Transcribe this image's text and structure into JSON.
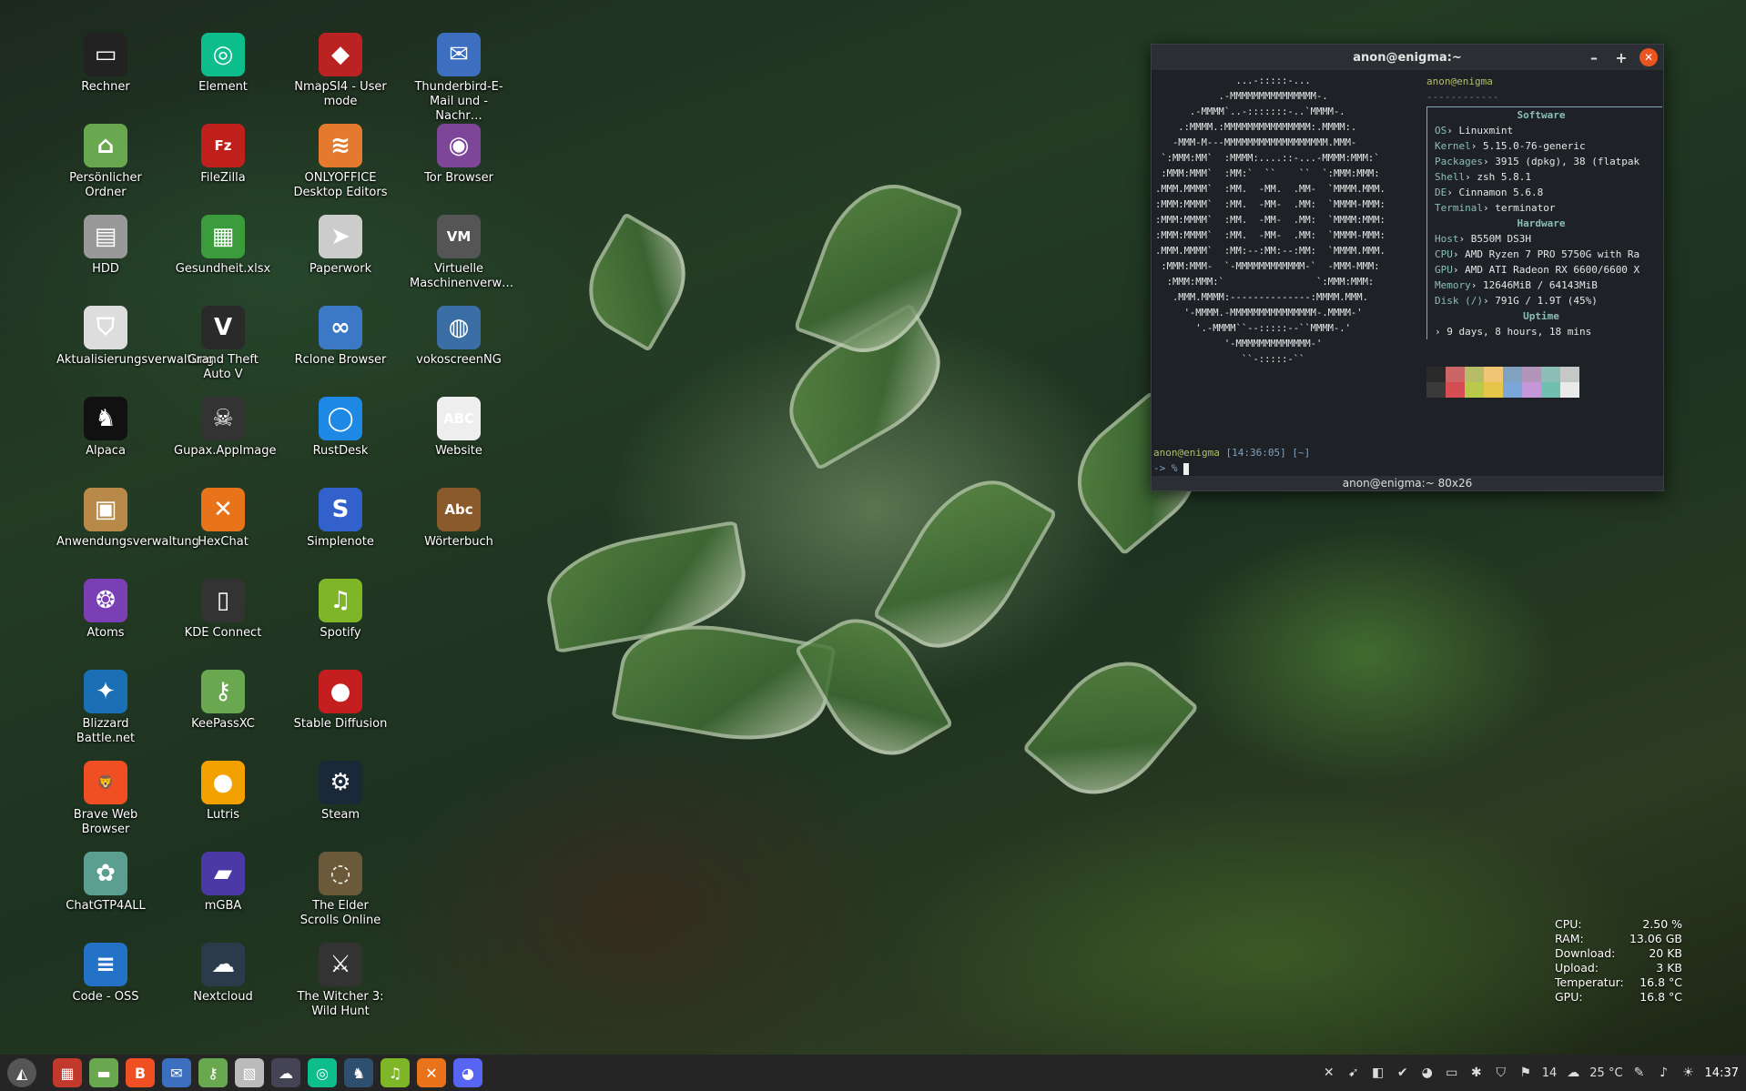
{
  "desktop_icons": [
    {
      "label": "Rechner",
      "glyph": "▭",
      "color": "#222"
    },
    {
      "label": "Element",
      "glyph": "◎",
      "color": "#0dbd8b"
    },
    {
      "label": "NmapSI4 - User mode",
      "glyph": "◆",
      "color": "#b22"
    },
    {
      "label": "Thunderbird-E-Mail und -Nachr…",
      "glyph": "✉",
      "color": "#3d6fc0"
    },
    {
      "label": "Persönlicher Ordner",
      "glyph": "⌂",
      "color": "#6aa84f"
    },
    {
      "label": "FileZilla",
      "glyph": "Fz",
      "color": "#c0201b"
    },
    {
      "label": "ONLYOFFICE Desktop Editors",
      "glyph": "≋",
      "color": "#e47a2e"
    },
    {
      "label": "Tor Browser",
      "glyph": "◉",
      "color": "#7d4698"
    },
    {
      "label": "HDD",
      "glyph": "▤",
      "color": "#999"
    },
    {
      "label": "Gesundheit.xlsx",
      "glyph": "▦",
      "color": "#3a9c3a"
    },
    {
      "label": "Paperwork",
      "glyph": "➤",
      "color": "#ccc"
    },
    {
      "label": "Virtuelle Maschinenverw…",
      "glyph": "VM",
      "color": "#555"
    },
    {
      "label": "Aktualisierungsverwaltung",
      "glyph": "⛉",
      "color": "#ddd"
    },
    {
      "label": "Grand Theft Auto V",
      "glyph": "V",
      "color": "#2a2a2a"
    },
    {
      "label": "Rclone Browser",
      "glyph": "∞",
      "color": "#3b79c7"
    },
    {
      "label": "vokoscreenNG",
      "glyph": "◍",
      "color": "#3b6ea5"
    },
    {
      "label": "Alpaca",
      "glyph": "♞",
      "color": "#111"
    },
    {
      "label": "Gupax.AppImage",
      "glyph": "☠",
      "color": "#333"
    },
    {
      "label": "RustDesk",
      "glyph": "◯",
      "color": "#1e88e5"
    },
    {
      "label": "Website",
      "glyph": "ABC",
      "color": "#eee"
    },
    {
      "label": "Anwendungsverwaltung",
      "glyph": "▣",
      "color": "#b9894a"
    },
    {
      "label": "HexChat",
      "glyph": "✕",
      "color": "#e8731a"
    },
    {
      "label": "Simplenote",
      "glyph": "S",
      "color": "#3361cc"
    },
    {
      "label": "Wörterbuch",
      "glyph": "Abc",
      "color": "#8b5a2b"
    },
    {
      "label": "Atoms",
      "glyph": "❂",
      "color": "#7b3fb5"
    },
    {
      "label": "KDE Connect",
      "glyph": "▯",
      "color": "#333"
    },
    {
      "label": "Spotify",
      "glyph": "♫",
      "color": "#7fb628"
    },
    {
      "label": "",
      "glyph": "",
      "color": "transparent"
    },
    {
      "label": "Blizzard Battle.net",
      "glyph": "✦",
      "color": "#1a6fb5"
    },
    {
      "label": "KeePassXC",
      "glyph": "⚷",
      "color": "#6aa84f"
    },
    {
      "label": "Stable Diffusion",
      "glyph": "●",
      "color": "#c41e1e"
    },
    {
      "label": "",
      "glyph": "",
      "color": "transparent"
    },
    {
      "label": "Brave Web Browser",
      "glyph": "🦁",
      "color": "#f04e23"
    },
    {
      "label": "Lutris",
      "glyph": "●",
      "color": "#f2a100"
    },
    {
      "label": "Steam",
      "glyph": "⚙",
      "color": "#1b2838"
    },
    {
      "label": "",
      "glyph": "",
      "color": "transparent"
    },
    {
      "label": "ChatGTP4ALL",
      "glyph": "✿",
      "color": "#5a9f90"
    },
    {
      "label": "mGBA",
      "glyph": "▰",
      "color": "#4b3aa5"
    },
    {
      "label": "The Elder Scrolls Online",
      "glyph": "◌",
      "color": "#6b5a3a"
    },
    {
      "label": "",
      "glyph": "",
      "color": "transparent"
    },
    {
      "label": "Code - OSS",
      "glyph": "≡",
      "color": "#2372c8"
    },
    {
      "label": "Nextcloud",
      "glyph": "☁",
      "color": "#2b3b4b"
    },
    {
      "label": "The Witcher 3: Wild Hunt",
      "glyph": "⚔",
      "color": "#333"
    }
  ],
  "terminal": {
    "title": "anon@enigma:~",
    "ascii": "              ...-:::::-...\n           .-MMMMMMMMMMMMMMM-.\n      .-MMMM`..-:::::::-..`MMMM-.\n    .:MMMM.:MMMMMMMMMMMMMMM:.MMMM:.\n   -MMM-M---MMMMMMMMMMMMMMMMMM.MMM-\n `:MMM:MM`  :MMMM:....::-...-MMMM:MMM:`\n :MMM:MMM`  :MM:`  ``    ``  `:MMM:MMM:\n.MMM.MMMM`  :MM.  -MM.  .MM-  `MMMM.MMM.\n:MMM:MMMM`  :MM.  -MM-  .MM:  `MMMM-MMM:\n:MMM:MMMM`  :MM.  -MM-  .MM:  `MMMM:MMM:\n:MMM:MMMM`  :MM.  -MM-  .MM:  `MMMM-MMM:\n.MMM.MMMM`  :MM:--:MM:--:MM:  `MMMM.MMM.\n :MMM:MMM-  `-MMMMMMMMMMMM-`  -MMM-MMM:\n  :MMM:MMM:`                `:MMM:MMM:\n   .MMM.MMMM:--------------:MMMM.MMM.\n     '-MMMM.-MMMMMMMMMMMMMMM-.MMMM-'\n       '.-MMMM``--:::::--``MMMM-.'\n            '-MMMMMMMMMMMMM-'\n               ``-:::::-``",
    "user_host": "anon@enigma",
    "rule": "------------",
    "software_header": "Software",
    "software": [
      {
        "k": "OS",
        "v": "Linuxmint"
      },
      {
        "k": "Kernel",
        "v": "5.15.0-76-generic"
      },
      {
        "k": "Packages",
        "v": "3915 (dpkg), 38 (flatpak"
      },
      {
        "k": "Shell",
        "v": "zsh 5.8.1"
      },
      {
        "k": "DE",
        "v": "Cinnamon 5.6.8"
      },
      {
        "k": "Terminal",
        "v": "terminator"
      }
    ],
    "hardware_header": "Hardware",
    "hardware": [
      {
        "k": "Host",
        "v": "B550M DS3H"
      },
      {
        "k": "CPU",
        "v": "AMD Ryzen 7 PRO 5750G with Ra"
      },
      {
        "k": "GPU",
        "v": "AMD ATI Radeon RX 6600/6600 X"
      },
      {
        "k": "Memory",
        "v": "12646MiB / 64143MiB"
      },
      {
        "k": "Disk (/)",
        "v": "791G / 1.9T (45%)"
      }
    ],
    "uptime_header": "Uptime",
    "uptime": "9 days, 8 hours, 18 mins",
    "palette": [
      "#2a2a2a",
      "#cc6666",
      "#b5bd68",
      "#f0c674",
      "#81a2be",
      "#b294bb",
      "#8abeb7",
      "#c5c8c6",
      "#3a3a3a",
      "#d54e53",
      "#b9ca4a",
      "#e7c547",
      "#7aa6da",
      "#c397d8",
      "#70c0b1",
      "#eaeaea"
    ],
    "prompt_user": "anon@enigma",
    "prompt_time": "[14:36:05]",
    "prompt_dir": "[~]",
    "prompt_line": "-> %",
    "status": "anon@enigma:~ 80x26"
  },
  "conky": [
    {
      "k": "CPU:",
      "v": "2.50 %"
    },
    {
      "k": "RAM:",
      "v": "13.06 GB"
    },
    {
      "k": "Download:",
      "v": "20 KB"
    },
    {
      "k": "Upload:",
      "v": "3 KB"
    },
    {
      "k": "Temperatur:",
      "v": "16.8 °C"
    },
    {
      "k": "GPU:",
      "v": "16.8 °C"
    }
  ],
  "taskbar_apps": [
    {
      "name": "menu",
      "glyph": "◭",
      "color": "#555"
    },
    {
      "name": "hexchat-task",
      "glyph": "▦",
      "color": "#c0392b"
    },
    {
      "name": "files",
      "glyph": "▬",
      "color": "#6aa84f"
    },
    {
      "name": "brave",
      "glyph": "B",
      "color": "#f04e23"
    },
    {
      "name": "thunderbird",
      "glyph": "✉",
      "color": "#3d6fc0"
    },
    {
      "name": "keepassxc",
      "glyph": "⚷",
      "color": "#6aa84f"
    },
    {
      "name": "image",
      "glyph": "▧",
      "color": "#bbb"
    },
    {
      "name": "nextcloud",
      "glyph": "☁",
      "color": "#445"
    },
    {
      "name": "element",
      "glyph": "◎",
      "color": "#0dbd8b"
    },
    {
      "name": "alpaca",
      "glyph": "♞",
      "color": "#2f4f6f"
    },
    {
      "name": "spotify",
      "glyph": "♫",
      "color": "#7fb628"
    },
    {
      "name": "hexchat",
      "glyph": "✕",
      "color": "#e8731a"
    },
    {
      "name": "discord",
      "glyph": "◕",
      "color": "#5865f2"
    }
  ],
  "tray": {
    "icons": [
      "✕",
      "➹",
      "◧",
      "✔",
      "◕",
      "▭",
      "✱",
      "⛉",
      "⚑"
    ],
    "notif_count": "14",
    "weather": "25 °C",
    "clock": "14:37"
  }
}
